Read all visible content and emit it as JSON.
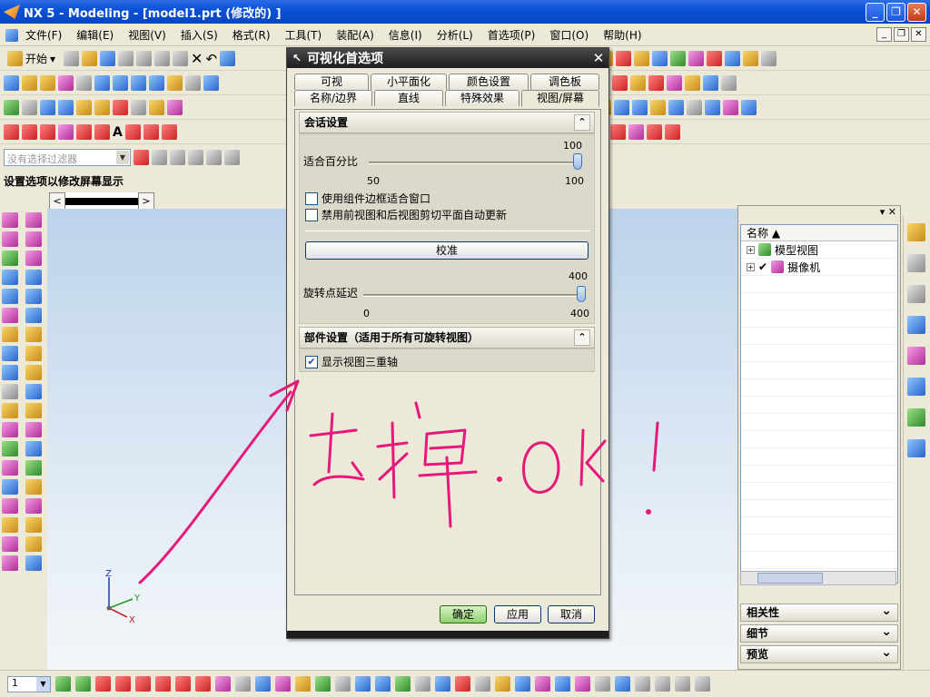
{
  "window": {
    "title": "NX 5 - Modeling - [model1.prt  (修改的) ]",
    "min": "_",
    "max": "❐",
    "close": "✕"
  },
  "menu": [
    "文件(F)",
    "编辑(E)",
    "视图(V)",
    "插入(S)",
    "格式(R)",
    "工具(T)",
    "装配(A)",
    "信息(I)",
    "分析(L)",
    "首选项(P)",
    "窗口(O)",
    "帮助(H)"
  ],
  "toolbar": {
    "start_label": "开始",
    "filter_placeholder": "没有选择过滤器"
  },
  "cue_line": "设置选项以修改屏幕显示",
  "dialog": {
    "title": "可视化首选项",
    "close": "✕",
    "tabs_row1": [
      "可视",
      "小平面化",
      "颜色设置",
      "调色板"
    ],
    "tabs_row2": [
      "名称/边界",
      "直线",
      "特殊效果",
      "视图/屏幕"
    ],
    "session": {
      "header": "会话设置",
      "fit_label": "适合百分比",
      "fit_value": "100",
      "fit_min": "50",
      "fit_max": "100",
      "fit_fraction": 1.0,
      "opt1": "使用组件边框适合窗口",
      "opt2": "禁用前视图和后视图剪切平面自动更新",
      "calibrate": "校准",
      "rotate_label": "旋转点延迟",
      "rotate_value": "400",
      "rotate_min": "0",
      "rotate_max": "400",
      "rotate_fraction": 1.0
    },
    "part": {
      "header": "部件设置（适用于所有可旋转视图）",
      "triad_label": "显示视图三重轴",
      "triad_checked": true
    },
    "ok": "确定",
    "apply": "应用",
    "cancel": "取消"
  },
  "navigator": {
    "column": "名称",
    "rows": [
      {
        "label": "模型视图",
        "checked": false
      },
      {
        "label": "摄像机",
        "checked": true
      }
    ],
    "sections": [
      "相关性",
      "细节",
      "预览"
    ]
  },
  "bottom": {
    "layer": "1"
  },
  "axes": {
    "z": "Z",
    "y": "Y",
    "x": "X"
  },
  "colors": {
    "xp_blue": "#0a52d8",
    "annotation": "#e6197a",
    "dialog_title": "#1d1d1d"
  },
  "annotation_text": "去掉.ok!"
}
